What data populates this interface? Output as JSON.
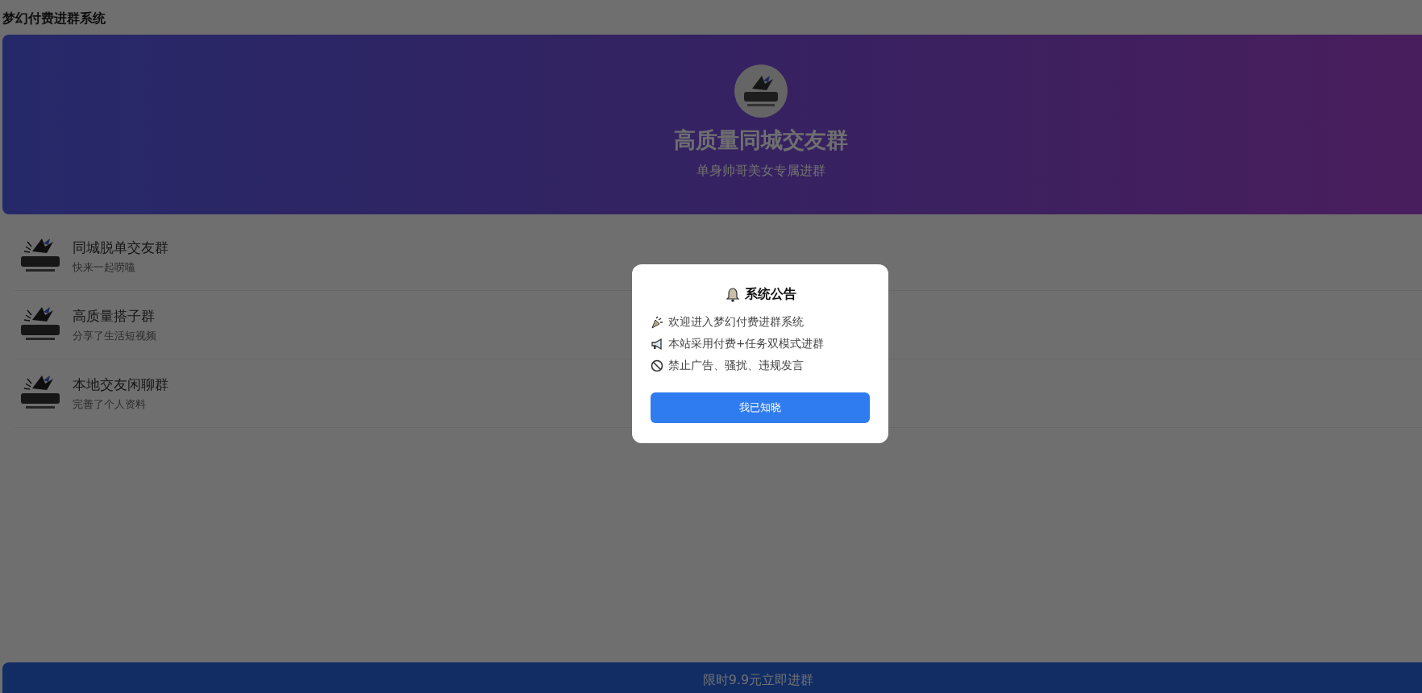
{
  "header": {
    "title": "梦幻付费进群系统"
  },
  "banner": {
    "title": "高质量同城交友群",
    "subtitle": "单身帅哥美女专属进群"
  },
  "groups": [
    {
      "name": "同城脱单交友群",
      "desc": "快来一起唠嗑"
    },
    {
      "name": "高质量搭子群",
      "desc": "分享了生活短视频"
    },
    {
      "name": "本地交友闲聊群",
      "desc": "完善了个人资料"
    }
  ],
  "join_button": {
    "label": "限时9.9元立即进群"
  },
  "dialog": {
    "title": "系统公告",
    "notices": [
      {
        "kind": "welcome",
        "text": "欢迎进入梦幻付费进群系统"
      },
      {
        "kind": "announce",
        "text": "本站采用付费+任务双模式进群"
      },
      {
        "kind": "forbid",
        "text": "禁止广告、骚扰、违规发言"
      }
    ],
    "button": "我已知晓"
  }
}
